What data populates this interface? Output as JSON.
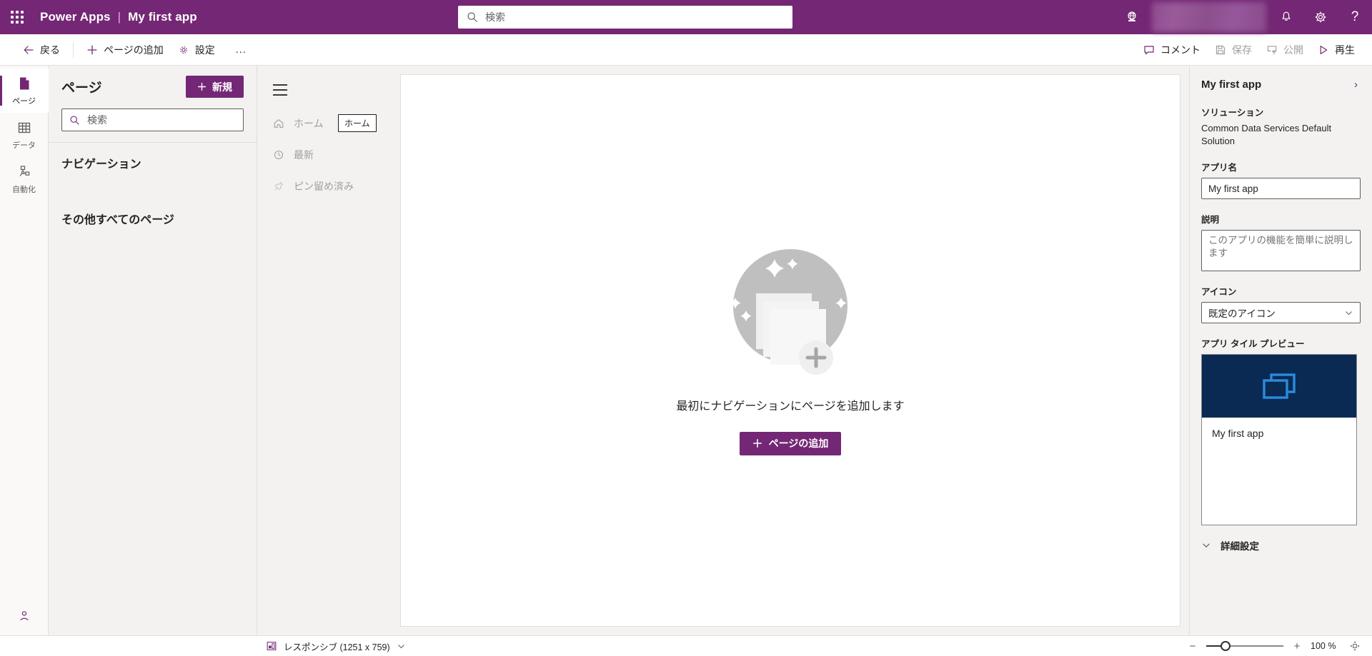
{
  "header": {
    "waffle_icon": "waffle-icon",
    "brand": "Power Apps",
    "separator": "|",
    "app_title": "My first app",
    "search": {
      "placeholder": "検索",
      "value": "",
      "icon": "search-icon"
    },
    "globe_icon": "globe-icon",
    "notifications_icon": "bell-icon",
    "settings_icon": "gear-icon",
    "help_icon": "help-icon",
    "brand_color": "#742774"
  },
  "commandbar": {
    "back": "戻る",
    "add_page": "ページの追加",
    "settings": "設定",
    "more": "…",
    "comment": "コメント",
    "save": "保存",
    "publish": "公開",
    "play": "再生"
  },
  "rail": {
    "items": [
      {
        "label": "ページ",
        "icon": "page-icon",
        "active": true
      },
      {
        "label": "データ",
        "icon": "table-icon",
        "active": false
      },
      {
        "label": "自動化",
        "icon": "flow-icon",
        "active": false
      }
    ],
    "bottom_icon": "person-accounts-icon"
  },
  "pages_panel": {
    "title": "ページ",
    "new_button": "新規",
    "search": {
      "placeholder": "検索",
      "value": ""
    },
    "sections": [
      {
        "label": "ナビゲーション"
      },
      {
        "label": "その他すべてのページ"
      }
    ]
  },
  "app_nav": {
    "hamburger_icon": "hamburger-icon",
    "items": [
      {
        "label": "ホーム",
        "icon": "home-icon"
      },
      {
        "label": "最新",
        "icon": "clock-icon"
      },
      {
        "label": "ピン留め済み",
        "icon": "pin-icon"
      }
    ],
    "tooltip": "ホーム"
  },
  "empty_state": {
    "illustration": "add-pages-illustration",
    "message": "最初にナビゲーションにページを追加します",
    "button": "ページの追加"
  },
  "properties": {
    "title": "My first app",
    "expand_icon": "chevron-right-icon",
    "solution_label": "ソリューション",
    "solution_value": "Common Data Services Default Solution",
    "app_name_label": "アプリ名",
    "app_name_value": "My first app",
    "description_label": "説明",
    "description_placeholder": "このアプリの機能を簡単に説明します",
    "description_value": "",
    "icon_label": "アイコン",
    "icon_value": "既定のアイコン",
    "tile_preview_label": "アプリ タイル プレビュー",
    "tile_name": "My first app",
    "tile_color": "#0a2a54",
    "tile_icon_color": "#2a8cdb",
    "advanced_label": "詳細設定"
  },
  "statusbar": {
    "layout_icon": "responsive-icon",
    "layout_label": "レスポンシブ (1251 x 759)",
    "layout_chevron": "chevron-down-icon",
    "zoom_out": "−",
    "zoom_in": "+",
    "zoom_value": "100 %",
    "fit_icon": "fit-to-screen-icon"
  }
}
